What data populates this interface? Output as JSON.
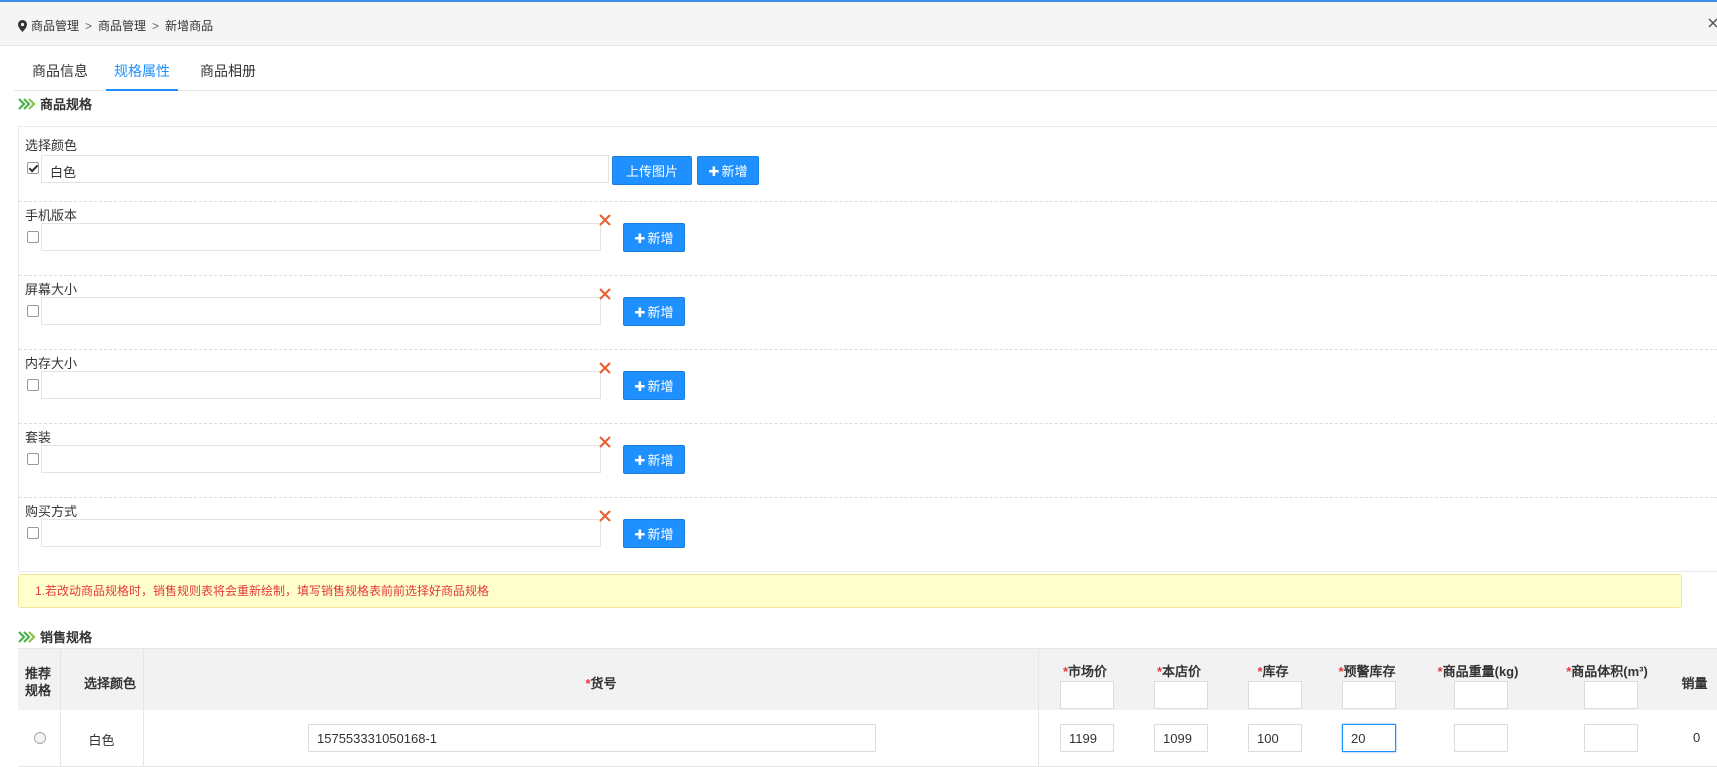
{
  "breadcrumb": {
    "items": [
      "商品管理",
      "商品管理",
      "新增商品"
    ],
    "separator": ">"
  },
  "tabs": [
    {
      "label": "商品信息",
      "active": false
    },
    {
      "label": "规格属性",
      "active": true
    },
    {
      "label": "商品相册",
      "active": false
    }
  ],
  "product_spec": {
    "title": "商品规格",
    "groups": [
      {
        "label": "选择颜色",
        "checked": true,
        "value": "白色",
        "upload_label": "上传图片",
        "add_label": "新增",
        "has_delete": false
      },
      {
        "label": "手机版本",
        "checked": false,
        "value": "",
        "add_label": "新增",
        "has_delete": true
      },
      {
        "label": "屏幕大小",
        "checked": false,
        "value": "",
        "add_label": "新增",
        "has_delete": true
      },
      {
        "label": "内存大小",
        "checked": false,
        "value": "",
        "add_label": "新增",
        "has_delete": true
      },
      {
        "label": "套装",
        "checked": false,
        "value": "",
        "add_label": "新增",
        "has_delete": true
      },
      {
        "label": "购买方式",
        "checked": false,
        "value": "",
        "add_label": "新增",
        "has_delete": true
      }
    ]
  },
  "notice": "1.若改动商品规格时，销售规则表将会重新绘制，填写销售规格表前前选择好商品规格",
  "sales_spec": {
    "title": "销售规格",
    "headers": {
      "recommend": "推荐规格",
      "color": "选择颜色",
      "sku": "货号",
      "market_price": "市场价",
      "shop_price": "本店价",
      "stock": "库存",
      "warn_stock": "预警库存",
      "weight": "商品重量(kg)",
      "volume": "商品体积(m³)",
      "sales": "销量"
    },
    "required_mark": "*",
    "row": {
      "color": "白色",
      "sku": "157553331050168-1",
      "market_price": "1199",
      "shop_price": "1099",
      "stock": "100",
      "warn_stock": "20",
      "weight": "",
      "volume": "",
      "sales": "0"
    }
  },
  "colors": {
    "primary": "#1e90ff",
    "danger": "#e4393c",
    "notice_bg": "#ffffcc",
    "chevron": "#4caf50"
  }
}
